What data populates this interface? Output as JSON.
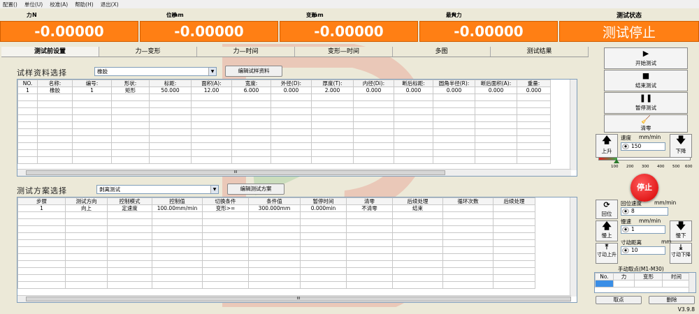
{
  "menu": [
    "配置()",
    "单位(U)",
    "校准(A)",
    "帮助(H)",
    "退出(X)"
  ],
  "header": {
    "cells": [
      {
        "label": "力",
        "unit": "N"
      },
      {
        "label": "位移",
        "unit": "mm"
      },
      {
        "label": "变形",
        "unit": "mm"
      },
      {
        "label": "最大力",
        "unit": "N"
      }
    ],
    "state_label": "测试状态"
  },
  "values": {
    "force": "-0.00000",
    "displacement": "-0.00000",
    "deformation": "-0.00000",
    "max_force": "-0.00000",
    "state": "测试停止"
  },
  "tabs": [
    "测试前设置",
    "力—变形",
    "力—时间",
    "变形—时间",
    "多图",
    "测试结果"
  ],
  "specimen": {
    "title": "试样资料选择",
    "selected": "橡胶",
    "edit_button": "编辑试样资料",
    "columns": [
      "NO.",
      "名称:",
      "编号:",
      "形状:",
      "标距:",
      "面积(A):",
      "宽度:",
      "外径(D):",
      "厚度(T):",
      "内径(Di):",
      "断后标距:",
      "圆角半径(R):",
      "断后面积(A):",
      "重量:"
    ],
    "rows": [
      [
        "1",
        "橡胶",
        "1",
        "矩形",
        "50.000",
        "12.00",
        "6.000",
        "0.000",
        "2.000",
        "0.000",
        "0.000",
        "0.000",
        "0.000",
        "0.000"
      ]
    ],
    "scroll_mark": "III"
  },
  "plan": {
    "title": "测试方案选择",
    "selected": "剥离测试",
    "edit_button": "编辑测试方案",
    "columns": [
      "步骤",
      "测试方向",
      "控制模式",
      "控制值",
      "切换条件",
      "条件值",
      "暂停时间",
      "清零",
      "后续处理",
      "循环次数",
      "后续处理"
    ],
    "rows": [
      [
        "1",
        "向上",
        "定速度",
        "100.00mm/min",
        "变形>=",
        "300.000mm",
        "0.000min",
        "不清零",
        "结束",
        "",
        ""
      ]
    ],
    "scroll_mark": "III"
  },
  "controls": {
    "start": "开始测试",
    "end": "结束测试",
    "pause": "暂停测试",
    "zero": "清零",
    "up": "上升",
    "down": "下降",
    "speed_label": "速度",
    "speed_unit": "mm/min",
    "speed_value": "150",
    "slider_ticks": [
      "100",
      "200",
      "300",
      "400",
      "500",
      "600"
    ],
    "slider_fraction": 0.2,
    "stop": "停止",
    "return_label": "回位",
    "return_speed_label": "回位速度",
    "return_speed_unit": "mm/min",
    "return_speed_value": "8",
    "slow_up": "慢上",
    "slow_down": "慢下",
    "slow_speed_label": "慢速",
    "slow_speed_unit": "mm/min",
    "slow_speed_value": "1",
    "jog_up": "寸动上升",
    "jog_down": "寸动下降",
    "jog_label": "寸动距离",
    "jog_unit": "mm",
    "jog_value": "10",
    "manual_title": "手动取点(M1-M30)",
    "manual_columns": [
      "No.",
      "力",
      "变形",
      "时间"
    ],
    "take_point": "取点",
    "delete": "删除",
    "version": "V3.9.8"
  },
  "colors": {
    "accent": "#ff7f14",
    "stop": "#d60000"
  }
}
